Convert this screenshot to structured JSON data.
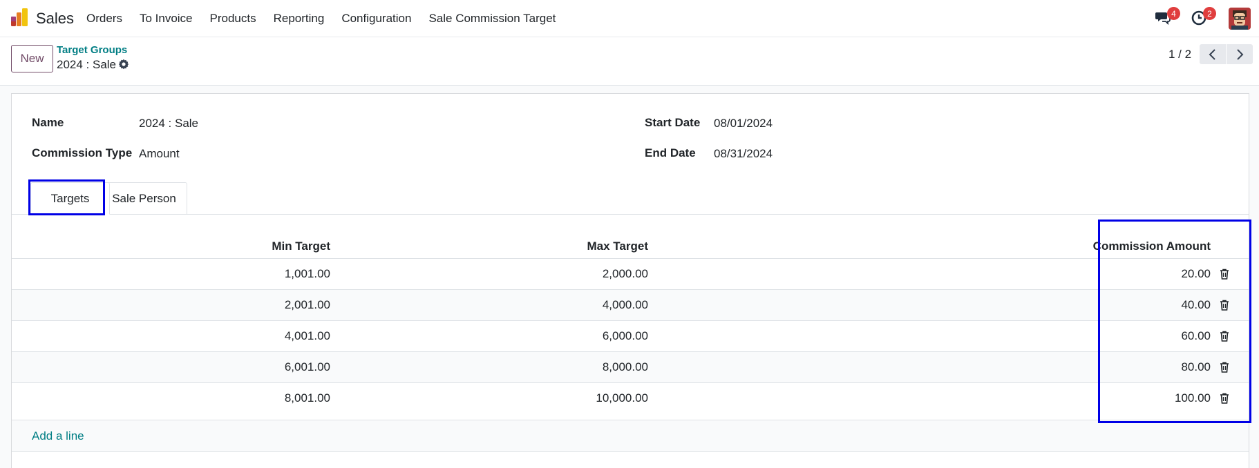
{
  "app": {
    "name": "Sales",
    "menu": [
      "Orders",
      "To Invoice",
      "Products",
      "Reporting",
      "Configuration",
      "Sale Commission Target"
    ],
    "messages_badge": "4",
    "activities_badge": "2"
  },
  "control_panel": {
    "new_label": "New",
    "breadcrumb": "Target Groups",
    "record_title": "2024 : Sale",
    "pager": "1 / 2"
  },
  "form": {
    "name_label": "Name",
    "name_value": "2024 : Sale",
    "commission_type_label": "Commission Type",
    "commission_type_value": "Amount",
    "start_date_label": "Start Date",
    "start_date_value": "08/01/2024",
    "end_date_label": "End Date",
    "end_date_value": "08/31/2024"
  },
  "tabs": [
    "Targets",
    "Sale Person"
  ],
  "table": {
    "headers": {
      "min": "Min Target",
      "max": "Max Target",
      "commission": "Commission Amount"
    },
    "rows": [
      {
        "min": "1,001.00",
        "max": "2,000.00",
        "commission": "20.00"
      },
      {
        "min": "2,001.00",
        "max": "4,000.00",
        "commission": "40.00"
      },
      {
        "min": "4,001.00",
        "max": "6,000.00",
        "commission": "60.00"
      },
      {
        "min": "6,001.00",
        "max": "8,000.00",
        "commission": "80.00"
      },
      {
        "min": "8,001.00",
        "max": "10,000.00",
        "commission": "100.00"
      }
    ],
    "add_line": "Add a line"
  },
  "colors": {
    "brand": "#714b67",
    "link": "#017e84",
    "highlight": "#0000e6",
    "badge": "#e03e3e"
  }
}
